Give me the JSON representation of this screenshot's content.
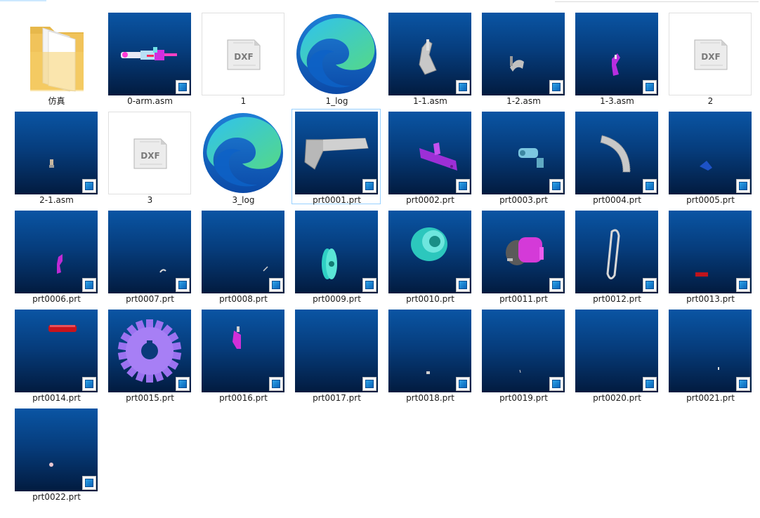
{
  "files": [
    {
      "name": "仿真",
      "kind": "folder",
      "icon": "folder-icon"
    },
    {
      "name": "0-arm.asm",
      "kind": "creo",
      "icon": "arm-assembly-icon"
    },
    {
      "name": "1",
      "kind": "dxf",
      "icon": "dxf-file-icon",
      "dxf_text": "DXF"
    },
    {
      "name": "1_log",
      "kind": "edge",
      "icon": "edge-browser-icon"
    },
    {
      "name": "1-1.asm",
      "kind": "creo",
      "icon": "assembly-icon"
    },
    {
      "name": "1-2.asm",
      "kind": "creo",
      "icon": "assembly-icon"
    },
    {
      "name": "1-3.asm",
      "kind": "creo",
      "icon": "assembly-icon"
    },
    {
      "name": "2",
      "kind": "dxf",
      "icon": "dxf-file-icon",
      "dxf_text": "DXF"
    },
    {
      "name": "2-1.asm",
      "kind": "creo",
      "icon": "assembly-icon"
    },
    {
      "name": "3",
      "kind": "dxf",
      "icon": "dxf-file-icon",
      "dxf_text": "DXF"
    },
    {
      "name": "3_log",
      "kind": "edge",
      "icon": "edge-browser-icon"
    },
    {
      "name": "prt0001.prt",
      "kind": "creo",
      "icon": "bracket-part-icon",
      "selected": true
    },
    {
      "name": "prt0002.prt",
      "kind": "creo",
      "icon": "part-icon"
    },
    {
      "name": "prt0003.prt",
      "kind": "creo",
      "icon": "part-icon"
    },
    {
      "name": "prt0004.prt",
      "kind": "creo",
      "icon": "gear-arc-part-icon"
    },
    {
      "name": "prt0005.prt",
      "kind": "creo",
      "icon": "part-icon"
    },
    {
      "name": "prt0006.prt",
      "kind": "creo",
      "icon": "part-icon"
    },
    {
      "name": "prt0007.prt",
      "kind": "creo",
      "icon": "part-icon"
    },
    {
      "name": "prt0008.prt",
      "kind": "creo",
      "icon": "part-icon"
    },
    {
      "name": "prt0009.prt",
      "kind": "creo",
      "icon": "pulley-part-icon"
    },
    {
      "name": "prt0010.prt",
      "kind": "creo",
      "icon": "pulley-part-icon"
    },
    {
      "name": "prt0011.prt",
      "kind": "creo",
      "icon": "motor-part-icon"
    },
    {
      "name": "prt0012.prt",
      "kind": "creo",
      "icon": "belt-part-icon"
    },
    {
      "name": "prt0013.prt",
      "kind": "creo",
      "icon": "part-icon"
    },
    {
      "name": "prt0014.prt",
      "kind": "creo",
      "icon": "part-icon"
    },
    {
      "name": "prt0015.prt",
      "kind": "creo",
      "icon": "gear-part-icon"
    },
    {
      "name": "prt0016.prt",
      "kind": "creo",
      "icon": "part-icon"
    },
    {
      "name": "prt0017.prt",
      "kind": "creo",
      "icon": "part-icon"
    },
    {
      "name": "prt0018.prt",
      "kind": "creo",
      "icon": "part-icon"
    },
    {
      "name": "prt0019.prt",
      "kind": "creo",
      "icon": "part-icon"
    },
    {
      "name": "prt0020.prt",
      "kind": "creo",
      "icon": "part-icon"
    },
    {
      "name": "prt0021.prt",
      "kind": "creo",
      "icon": "part-icon"
    },
    {
      "name": "prt0022.prt",
      "kind": "creo",
      "icon": "part-icon"
    }
  ],
  "colors": {
    "thumb_top": "#0a55a4",
    "thumb_bottom": "#021b3f",
    "selection_border": "#99d1ff",
    "label_text": "#1a1a1a"
  }
}
